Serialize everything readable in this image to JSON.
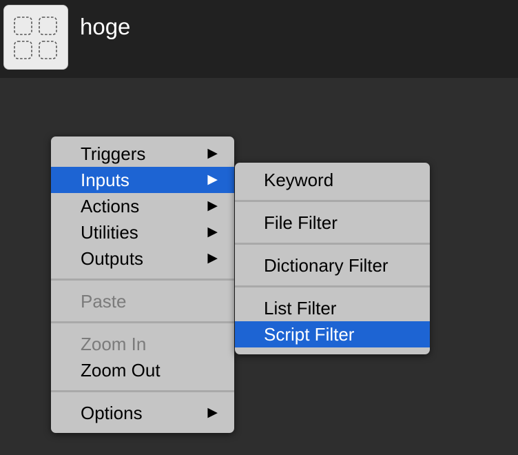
{
  "header": {
    "title": "hoge",
    "icon": "workflow-placeholder-icon"
  },
  "context_menu": {
    "items": [
      {
        "label": "Triggers",
        "submenu": true,
        "state": "normal"
      },
      {
        "label": "Inputs",
        "submenu": true,
        "state": "selected"
      },
      {
        "label": "Actions",
        "submenu": true,
        "state": "normal"
      },
      {
        "label": "Utilities",
        "submenu": true,
        "state": "normal"
      },
      {
        "label": "Outputs",
        "submenu": true,
        "state": "normal"
      },
      {
        "label": "Paste",
        "submenu": false,
        "state": "disabled"
      },
      {
        "label": "Zoom In",
        "submenu": false,
        "state": "disabled"
      },
      {
        "label": "Zoom Out",
        "submenu": false,
        "state": "normal"
      },
      {
        "label": "Options",
        "submenu": true,
        "state": "normal"
      }
    ],
    "arrow_glyph": "▶"
  },
  "inputs_submenu": {
    "items": [
      {
        "label": "Keyword",
        "state": "normal"
      },
      {
        "label": "File Filter",
        "state": "normal"
      },
      {
        "label": "Dictionary Filter",
        "state": "normal"
      },
      {
        "label": "List Filter",
        "state": "normal"
      },
      {
        "label": "Script Filter",
        "state": "selected"
      }
    ]
  },
  "colors": {
    "background": "#2e2e2e",
    "header": "#212121",
    "menu": "#c5c5c5",
    "highlight": "#1d64d3",
    "disabled_text": "#7b7b7b"
  }
}
